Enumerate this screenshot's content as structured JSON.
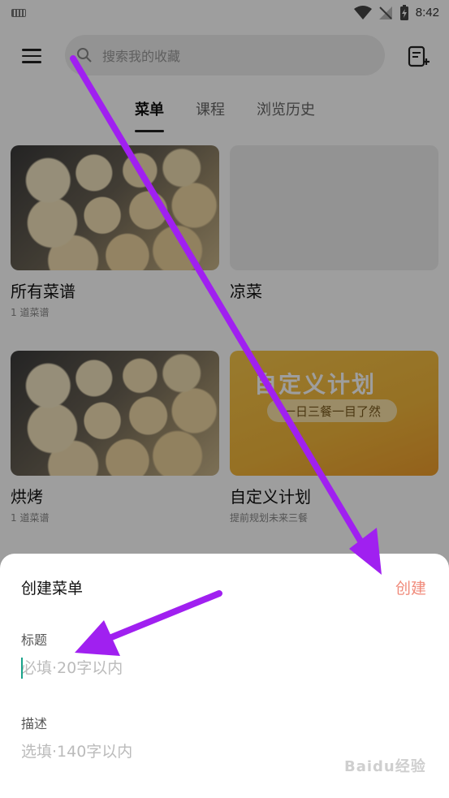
{
  "status_bar": {
    "time": "8:42"
  },
  "header": {
    "search_placeholder": "搜索我的收藏"
  },
  "tabs": [
    {
      "label": "菜单",
      "active": true
    },
    {
      "label": "课程",
      "active": false
    },
    {
      "label": "浏览历史",
      "active": false
    }
  ],
  "cards": [
    {
      "title": "所有菜谱",
      "subtitle": "1 道菜谱"
    },
    {
      "title": "凉菜",
      "subtitle": ""
    },
    {
      "title": "烘烤",
      "subtitle": "1 道菜谱"
    },
    {
      "title": "自定义计划",
      "subtitle": "提前规划未来三餐",
      "banner_text": "自定义计划",
      "banner_pill": "一日三餐一目了然"
    }
  ],
  "sheet": {
    "title": "创建菜单",
    "create_label": "创建",
    "title_field": {
      "label": "标题",
      "placeholder": "必填·20字以内"
    },
    "desc_field": {
      "label": "描述",
      "placeholder": "选填·140字以内"
    }
  },
  "watermark": "Baidu经验",
  "colors": {
    "accent": "#f08a7a",
    "annotation_arrow": "#a020f0",
    "caret": "#1aa38a"
  }
}
